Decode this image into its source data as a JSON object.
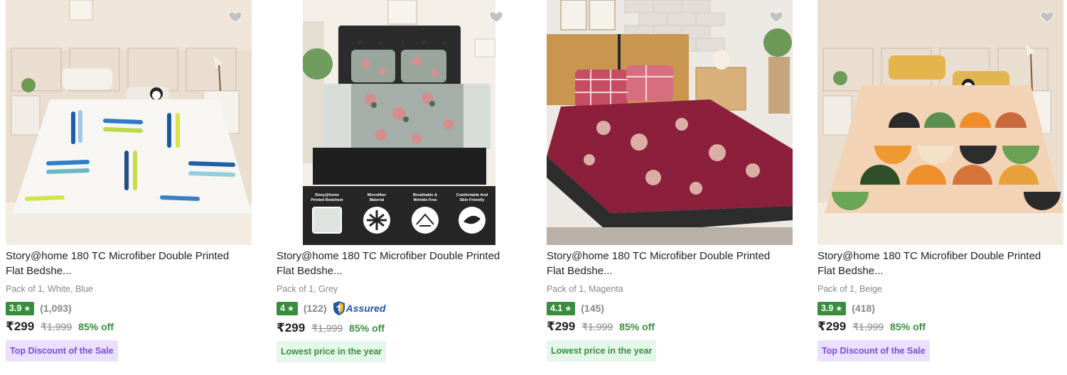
{
  "products": [
    {
      "title_line1": "Story@home 180 TC Microfiber Double Printed",
      "title_line2": "Flat Bedshe...",
      "variant": "Pack of 1, White, Blue",
      "rating": "3.9",
      "rating_count": "(1,093)",
      "assured": "",
      "price": "₹299",
      "mrp": "₹1,999",
      "discount": "85% off",
      "tag": "Top Discount of the Sale",
      "tag_style": "purple",
      "image_icon": "bedsheet-white-blue-image"
    },
    {
      "title_line1": "Story@home 180 TC Microfiber Double Printed",
      "title_line2": "Flat Bedshe...",
      "variant": "Pack of 1, Grey",
      "rating": "4",
      "rating_count": "(122)",
      "assured": "Assured",
      "price": "₹299",
      "mrp": "₹1,999",
      "discount": "85% off",
      "tag": "Lowest price in the year",
      "tag_style": "green",
      "image_icon": "bedsheet-grey-image",
      "features": [
        {
          "line1": "Story@home",
          "line2": "Printed Bedsheet"
        },
        {
          "line1": "Microfiber",
          "line2": "Material"
        },
        {
          "line1": "Breathable &",
          "line2": "Wrinkle Free"
        },
        {
          "line1": "Comfortable And",
          "line2": "Skin Friendly"
        }
      ]
    },
    {
      "title_line1": "Story@home 180 TC Microfiber Double Printed",
      "title_line2": "Flat Bedshe...",
      "variant": "Pack of 1, Magenta",
      "rating": "4.1",
      "rating_count": "(145)",
      "assured": "",
      "price": "₹299",
      "mrp": "₹1,999",
      "discount": "85% off",
      "tag": "Lowest price in the year",
      "tag_style": "green",
      "image_icon": "bedsheet-magenta-image"
    },
    {
      "title_line1": "Story@home 180 TC Microfiber Double Printed",
      "title_line2": "Flat Bedshe...",
      "variant": "Pack of 1, Beige",
      "rating": "3.9",
      "rating_count": "(418)",
      "assured": "",
      "price": "₹299",
      "mrp": "₹1,999",
      "discount": "85% off",
      "tag": "Top Discount of the Sale",
      "tag_style": "purple",
      "image_icon": "bedsheet-beige-image"
    }
  ],
  "colors": {
    "rating_green": "#388e3c",
    "discount_green": "#388e3c",
    "assured_blue": "#2455a6",
    "tag_purple_bg": "#ebe0ff",
    "tag_purple_text": "#7e4bd6",
    "tag_green_bg": "#e5f7ea"
  },
  "icons": {
    "wishlist": "heart-icon",
    "star": "star-icon",
    "assured": "assured-shield-icon"
  }
}
